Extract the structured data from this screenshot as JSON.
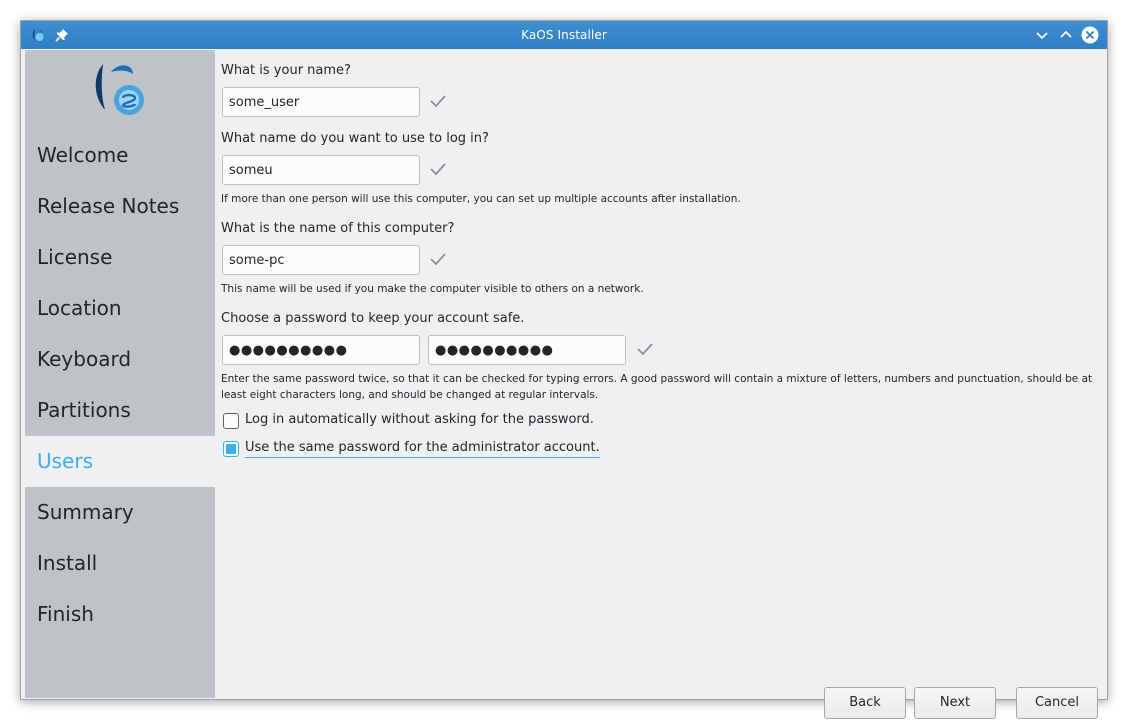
{
  "window": {
    "title": "KaOS Installer"
  },
  "sidebar": {
    "items": [
      {
        "label": "Welcome"
      },
      {
        "label": "Release Notes"
      },
      {
        "label": "License"
      },
      {
        "label": "Location"
      },
      {
        "label": "Keyboard"
      },
      {
        "label": "Partitions"
      },
      {
        "label": "Users"
      },
      {
        "label": "Summary"
      },
      {
        "label": "Install"
      },
      {
        "label": "Finish"
      }
    ],
    "active": "Users"
  },
  "form": {
    "name_label": "What is your name?",
    "name_value": "some_user",
    "login_label": "What name do you want to use to log in?",
    "login_value": "someu",
    "login_hint": "If more than one person will use this computer, you can set up multiple accounts after installation.",
    "computer_label": "What is the name of this computer?",
    "computer_value": "some-pc",
    "computer_hint": "This name will be used if you make the computer visible to others on a network.",
    "password_label": "Choose a password to keep your account safe.",
    "password_value": "●●●●●●●●●●",
    "password_confirm_value": "●●●●●●●●●●",
    "password_hint": "Enter the same password twice, so that it can be checked for typing errors. A good password will contain a mixture of letters, numbers and punctuation, should be at least eight characters long, and should be changed at regular intervals.",
    "autologin_label": "Log in automatically without asking for the password.",
    "autologin_checked": false,
    "same_admin_label": "Use the same password for the administrator account.",
    "same_admin_checked": true
  },
  "buttons": {
    "back": "Back",
    "next": "Next",
    "cancel": "Cancel"
  },
  "icons": {
    "app": "kaos-app-icon",
    "pin": "pin-icon",
    "minimize": "chevron-down-icon",
    "maximize": "chevron-up-icon",
    "close": "close-icon",
    "valid": "checkmark-icon"
  },
  "colors": {
    "accent": "#3daee9",
    "titlebar": "#3586c8",
    "sidebar": "#bdc3c7"
  }
}
